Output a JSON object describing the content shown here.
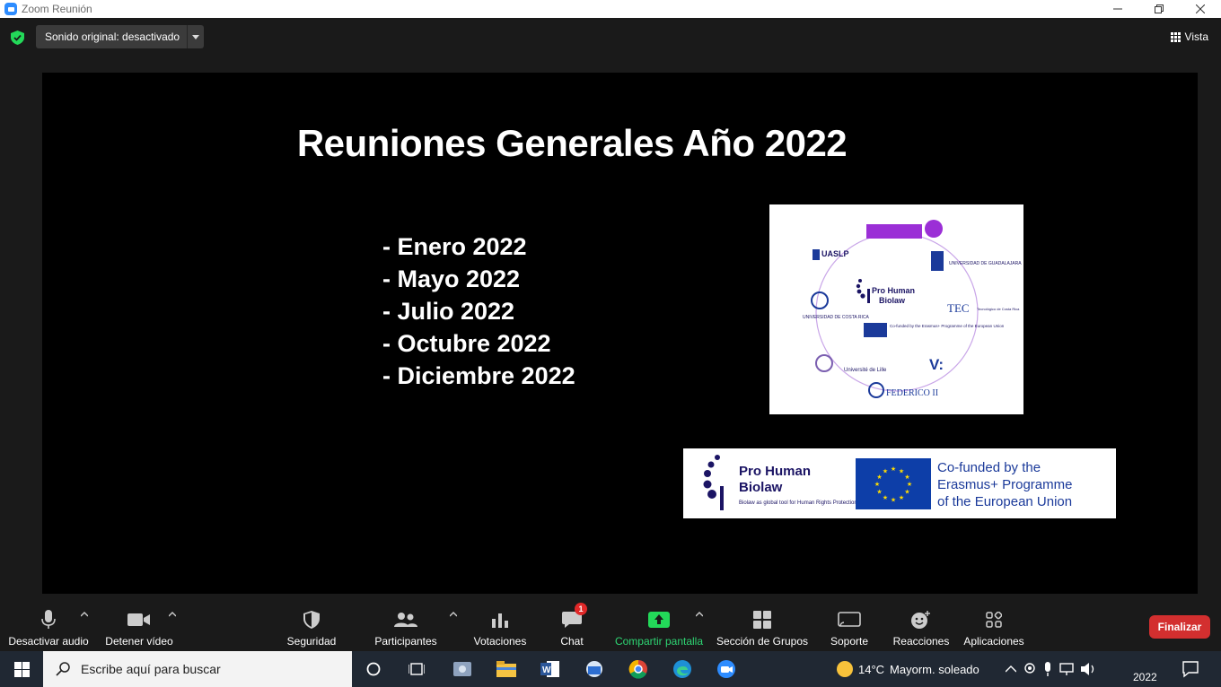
{
  "window": {
    "title": "Zoom Reunión"
  },
  "topbar": {
    "audio_label": "Sonido original: desactivado",
    "view_label": "Vista"
  },
  "slide": {
    "title": "Reuniones Generales Año 2022",
    "months": [
      "- Enero 2022",
      "- Mayo 2022",
      "- Julio 2022",
      "- Octubre 2022",
      "- Diciembre 2022"
    ],
    "banner": {
      "project_line1": "Pro Human",
      "project_line2": "Biolaw",
      "project_tagline": "Biolaw as global tool for Human Rights Protection",
      "cofund_line1": "Co-funded by the",
      "cofund_line2": "Erasmus+ Programme",
      "cofund_line3": "of the European Union"
    },
    "partners": {
      "uaslp": "UASLP",
      "tec": "TEC",
      "tec_sub": "Tecnológico de Costa Rica",
      "costa_rica": "UNIVERSIDAD DE COSTA RICA",
      "lille": "Université de Lille",
      "federico": "FEDERICO II",
      "guadalajara": "UNIVERSIDAD DE GUADALAJARA",
      "vanvitelli": "V:",
      "center_line1": "Pro Human",
      "center_line2": "Biolaw",
      "center_cofund": "Co-funded by the Erasmus+ Programme of the European Union"
    }
  },
  "toolbar": {
    "mute": "Desactivar audio",
    "video": "Detener vídeo",
    "security": "Seguridad",
    "participants": "Participantes",
    "polls": "Votaciones",
    "chat": "Chat",
    "chat_badge": "1",
    "share": "Compartir pantalla",
    "breakout": "Sección de Grupos",
    "support": "Soporte",
    "reactions": "Reacciones",
    "apps": "Aplicaciones",
    "end": "Finalizar"
  },
  "taskbar": {
    "search_placeholder": "Escribe aquí para buscar",
    "weather_temp": "14°C",
    "weather_desc": "Mayorm. soleado",
    "clock_date": "2022"
  },
  "colors": {
    "zoom_blue": "#2d8cff",
    "share_green": "#2ed573",
    "end_red": "#d32f2f",
    "chat_badge_red": "#e02828"
  }
}
